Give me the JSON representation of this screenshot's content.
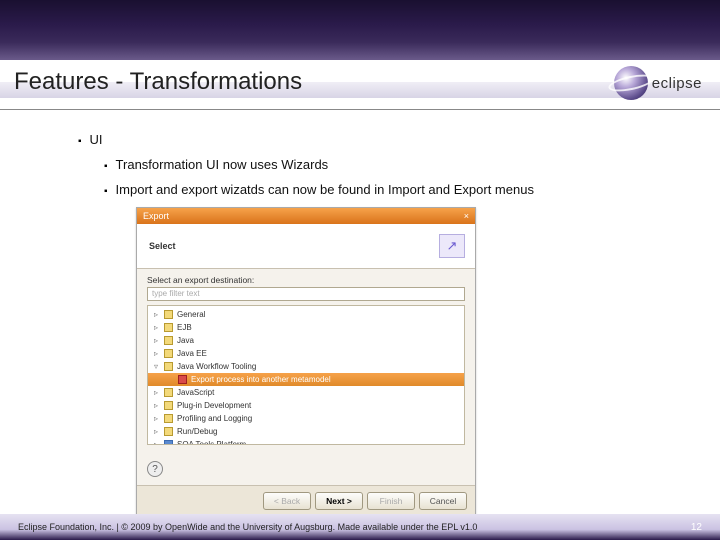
{
  "slide": {
    "title": "Features - Transformations",
    "logo_text": "eclipse"
  },
  "bullets": {
    "lvl1": "UI",
    "lvl2a": "Transformation UI now uses Wizards",
    "lvl2b": "Import and export wizatds can now be found in Import and Export menus"
  },
  "dialog": {
    "title": "Export",
    "close": "×",
    "banner": "Select",
    "dest_label": "Select an export destination:",
    "filter_placeholder": "type filter text",
    "tree": [
      {
        "type": "folder",
        "label": "General",
        "twisty": "▹"
      },
      {
        "type": "folder",
        "label": "EJB",
        "twisty": "▹"
      },
      {
        "type": "folder",
        "label": "Java",
        "twisty": "▹"
      },
      {
        "type": "folder",
        "label": "Java EE",
        "twisty": "▹"
      },
      {
        "type": "folder",
        "label": "Java Workflow Tooling",
        "twisty": "▿"
      },
      {
        "type": "file-sel",
        "label": "Export process into another metamodel",
        "twisty": ""
      },
      {
        "type": "folder",
        "label": "JavaScript",
        "twisty": "▹"
      },
      {
        "type": "folder",
        "label": "Plug-in Development",
        "twisty": "▹"
      },
      {
        "type": "folder",
        "label": "Profiling and Logging",
        "twisty": "▹"
      },
      {
        "type": "folder",
        "label": "Run/Debug",
        "twisty": "▹"
      },
      {
        "type": "folder",
        "label": "SOA Tools Platform",
        "twisty": "▹"
      }
    ],
    "help": "?",
    "buttons": {
      "back": "< Back",
      "next": "Next >",
      "finish": "Finish",
      "cancel": "Cancel"
    }
  },
  "footer": {
    "copyright": "Eclipse Foundation, Inc. | © 2009 by OpenWide and the University of Augsburg. Made available under the EPL v1.0",
    "page": "12"
  }
}
